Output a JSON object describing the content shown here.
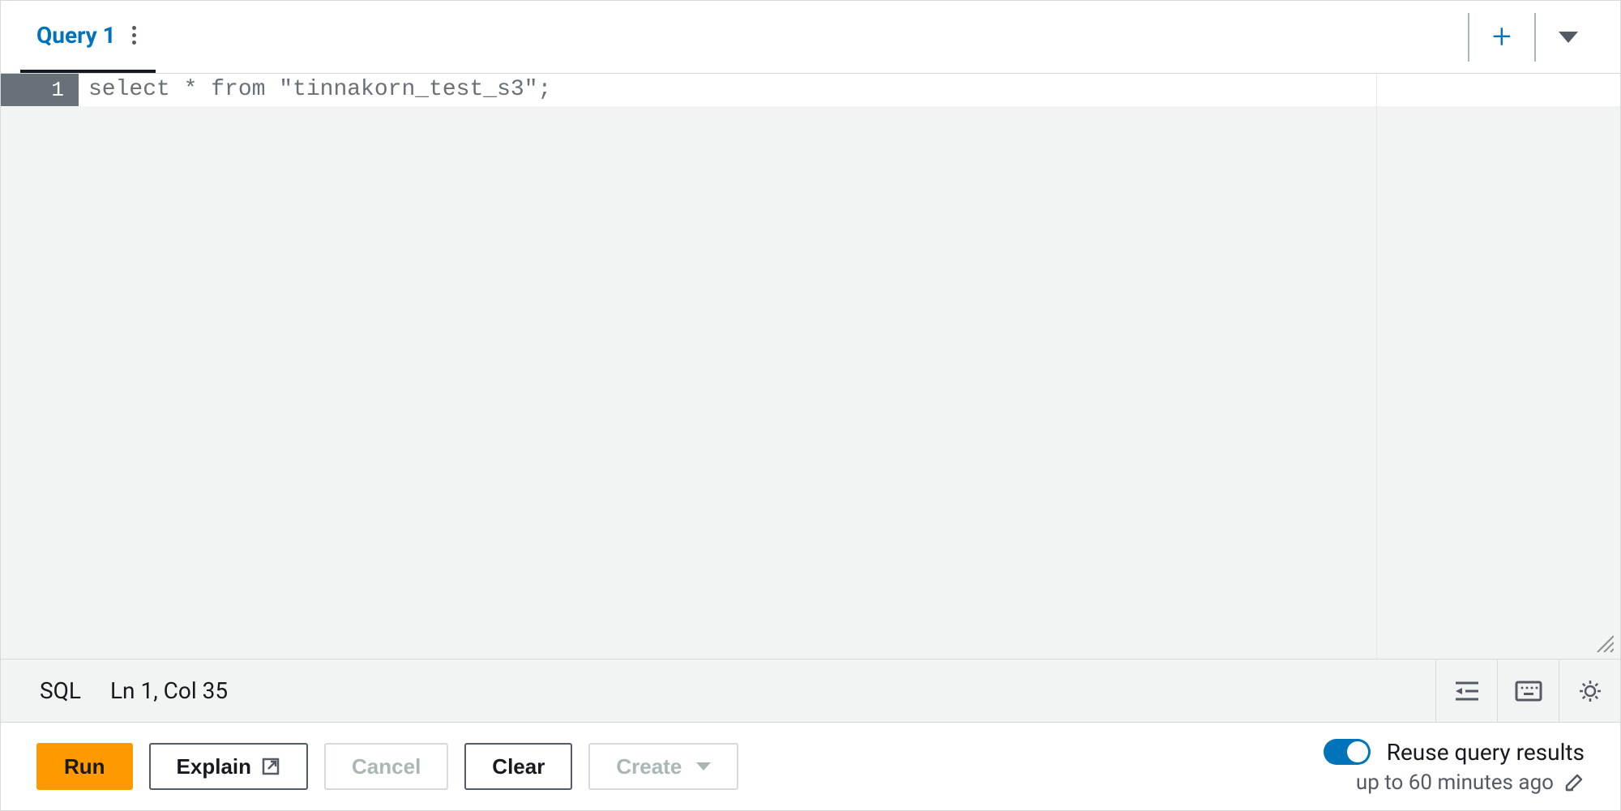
{
  "tabs": {
    "active_label": "Query 1"
  },
  "editor": {
    "lines": [
      {
        "number": "1",
        "content": "select * from \"tinnakorn_test_s3\";"
      }
    ]
  },
  "status_bar": {
    "language": "SQL",
    "position": "Ln 1, Col 35"
  },
  "action_bar": {
    "run_label": "Run",
    "explain_label": "Explain",
    "cancel_label": "Cancel",
    "clear_label": "Clear",
    "create_label": "Create"
  },
  "reuse": {
    "label": "Reuse query results",
    "subtext": "up to 60 minutes ago"
  }
}
